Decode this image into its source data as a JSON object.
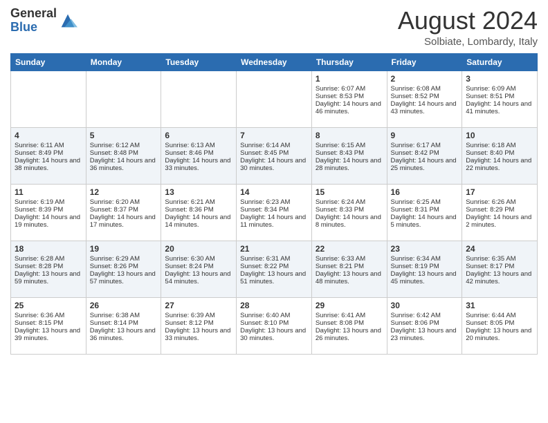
{
  "logo": {
    "general": "General",
    "blue": "Blue"
  },
  "title": "August 2024",
  "location": "Solbiate, Lombardy, Italy",
  "days_of_week": [
    "Sunday",
    "Monday",
    "Tuesday",
    "Wednesday",
    "Thursday",
    "Friday",
    "Saturday"
  ],
  "weeks": [
    [
      {
        "day": "",
        "sunrise": "",
        "sunset": "",
        "daylight": ""
      },
      {
        "day": "",
        "sunrise": "",
        "sunset": "",
        "daylight": ""
      },
      {
        "day": "",
        "sunrise": "",
        "sunset": "",
        "daylight": ""
      },
      {
        "day": "",
        "sunrise": "",
        "sunset": "",
        "daylight": ""
      },
      {
        "day": "1",
        "sunrise": "Sunrise: 6:07 AM",
        "sunset": "Sunset: 8:53 PM",
        "daylight": "Daylight: 14 hours and 46 minutes."
      },
      {
        "day": "2",
        "sunrise": "Sunrise: 6:08 AM",
        "sunset": "Sunset: 8:52 PM",
        "daylight": "Daylight: 14 hours and 43 minutes."
      },
      {
        "day": "3",
        "sunrise": "Sunrise: 6:09 AM",
        "sunset": "Sunset: 8:51 PM",
        "daylight": "Daylight: 14 hours and 41 minutes."
      }
    ],
    [
      {
        "day": "4",
        "sunrise": "Sunrise: 6:11 AM",
        "sunset": "Sunset: 8:49 PM",
        "daylight": "Daylight: 14 hours and 38 minutes."
      },
      {
        "day": "5",
        "sunrise": "Sunrise: 6:12 AM",
        "sunset": "Sunset: 8:48 PM",
        "daylight": "Daylight: 14 hours and 36 minutes."
      },
      {
        "day": "6",
        "sunrise": "Sunrise: 6:13 AM",
        "sunset": "Sunset: 8:46 PM",
        "daylight": "Daylight: 14 hours and 33 minutes."
      },
      {
        "day": "7",
        "sunrise": "Sunrise: 6:14 AM",
        "sunset": "Sunset: 8:45 PM",
        "daylight": "Daylight: 14 hours and 30 minutes."
      },
      {
        "day": "8",
        "sunrise": "Sunrise: 6:15 AM",
        "sunset": "Sunset: 8:43 PM",
        "daylight": "Daylight: 14 hours and 28 minutes."
      },
      {
        "day": "9",
        "sunrise": "Sunrise: 6:17 AM",
        "sunset": "Sunset: 8:42 PM",
        "daylight": "Daylight: 14 hours and 25 minutes."
      },
      {
        "day": "10",
        "sunrise": "Sunrise: 6:18 AM",
        "sunset": "Sunset: 8:40 PM",
        "daylight": "Daylight: 14 hours and 22 minutes."
      }
    ],
    [
      {
        "day": "11",
        "sunrise": "Sunrise: 6:19 AM",
        "sunset": "Sunset: 8:39 PM",
        "daylight": "Daylight: 14 hours and 19 minutes."
      },
      {
        "day": "12",
        "sunrise": "Sunrise: 6:20 AM",
        "sunset": "Sunset: 8:37 PM",
        "daylight": "Daylight: 14 hours and 17 minutes."
      },
      {
        "day": "13",
        "sunrise": "Sunrise: 6:21 AM",
        "sunset": "Sunset: 8:36 PM",
        "daylight": "Daylight: 14 hours and 14 minutes."
      },
      {
        "day": "14",
        "sunrise": "Sunrise: 6:23 AM",
        "sunset": "Sunset: 8:34 PM",
        "daylight": "Daylight: 14 hours and 11 minutes."
      },
      {
        "day": "15",
        "sunrise": "Sunrise: 6:24 AM",
        "sunset": "Sunset: 8:33 PM",
        "daylight": "Daylight: 14 hours and 8 minutes."
      },
      {
        "day": "16",
        "sunrise": "Sunrise: 6:25 AM",
        "sunset": "Sunset: 8:31 PM",
        "daylight": "Daylight: 14 hours and 5 minutes."
      },
      {
        "day": "17",
        "sunrise": "Sunrise: 6:26 AM",
        "sunset": "Sunset: 8:29 PM",
        "daylight": "Daylight: 14 hours and 2 minutes."
      }
    ],
    [
      {
        "day": "18",
        "sunrise": "Sunrise: 6:28 AM",
        "sunset": "Sunset: 8:28 PM",
        "daylight": "Daylight: 13 hours and 59 minutes."
      },
      {
        "day": "19",
        "sunrise": "Sunrise: 6:29 AM",
        "sunset": "Sunset: 8:26 PM",
        "daylight": "Daylight: 13 hours and 57 minutes."
      },
      {
        "day": "20",
        "sunrise": "Sunrise: 6:30 AM",
        "sunset": "Sunset: 8:24 PM",
        "daylight": "Daylight: 13 hours and 54 minutes."
      },
      {
        "day": "21",
        "sunrise": "Sunrise: 6:31 AM",
        "sunset": "Sunset: 8:22 PM",
        "daylight": "Daylight: 13 hours and 51 minutes."
      },
      {
        "day": "22",
        "sunrise": "Sunrise: 6:33 AM",
        "sunset": "Sunset: 8:21 PM",
        "daylight": "Daylight: 13 hours and 48 minutes."
      },
      {
        "day": "23",
        "sunrise": "Sunrise: 6:34 AM",
        "sunset": "Sunset: 8:19 PM",
        "daylight": "Daylight: 13 hours and 45 minutes."
      },
      {
        "day": "24",
        "sunrise": "Sunrise: 6:35 AM",
        "sunset": "Sunset: 8:17 PM",
        "daylight": "Daylight: 13 hours and 42 minutes."
      }
    ],
    [
      {
        "day": "25",
        "sunrise": "Sunrise: 6:36 AM",
        "sunset": "Sunset: 8:15 PM",
        "daylight": "Daylight: 13 hours and 39 minutes."
      },
      {
        "day": "26",
        "sunrise": "Sunrise: 6:38 AM",
        "sunset": "Sunset: 8:14 PM",
        "daylight": "Daylight: 13 hours and 36 minutes."
      },
      {
        "day": "27",
        "sunrise": "Sunrise: 6:39 AM",
        "sunset": "Sunset: 8:12 PM",
        "daylight": "Daylight: 13 hours and 33 minutes."
      },
      {
        "day": "28",
        "sunrise": "Sunrise: 6:40 AM",
        "sunset": "Sunset: 8:10 PM",
        "daylight": "Daylight: 13 hours and 30 minutes."
      },
      {
        "day": "29",
        "sunrise": "Sunrise: 6:41 AM",
        "sunset": "Sunset: 8:08 PM",
        "daylight": "Daylight: 13 hours and 26 minutes."
      },
      {
        "day": "30",
        "sunrise": "Sunrise: 6:42 AM",
        "sunset": "Sunset: 8:06 PM",
        "daylight": "Daylight: 13 hours and 23 minutes."
      },
      {
        "day": "31",
        "sunrise": "Sunrise: 6:44 AM",
        "sunset": "Sunset: 8:05 PM",
        "daylight": "Daylight: 13 hours and 20 minutes."
      }
    ]
  ]
}
